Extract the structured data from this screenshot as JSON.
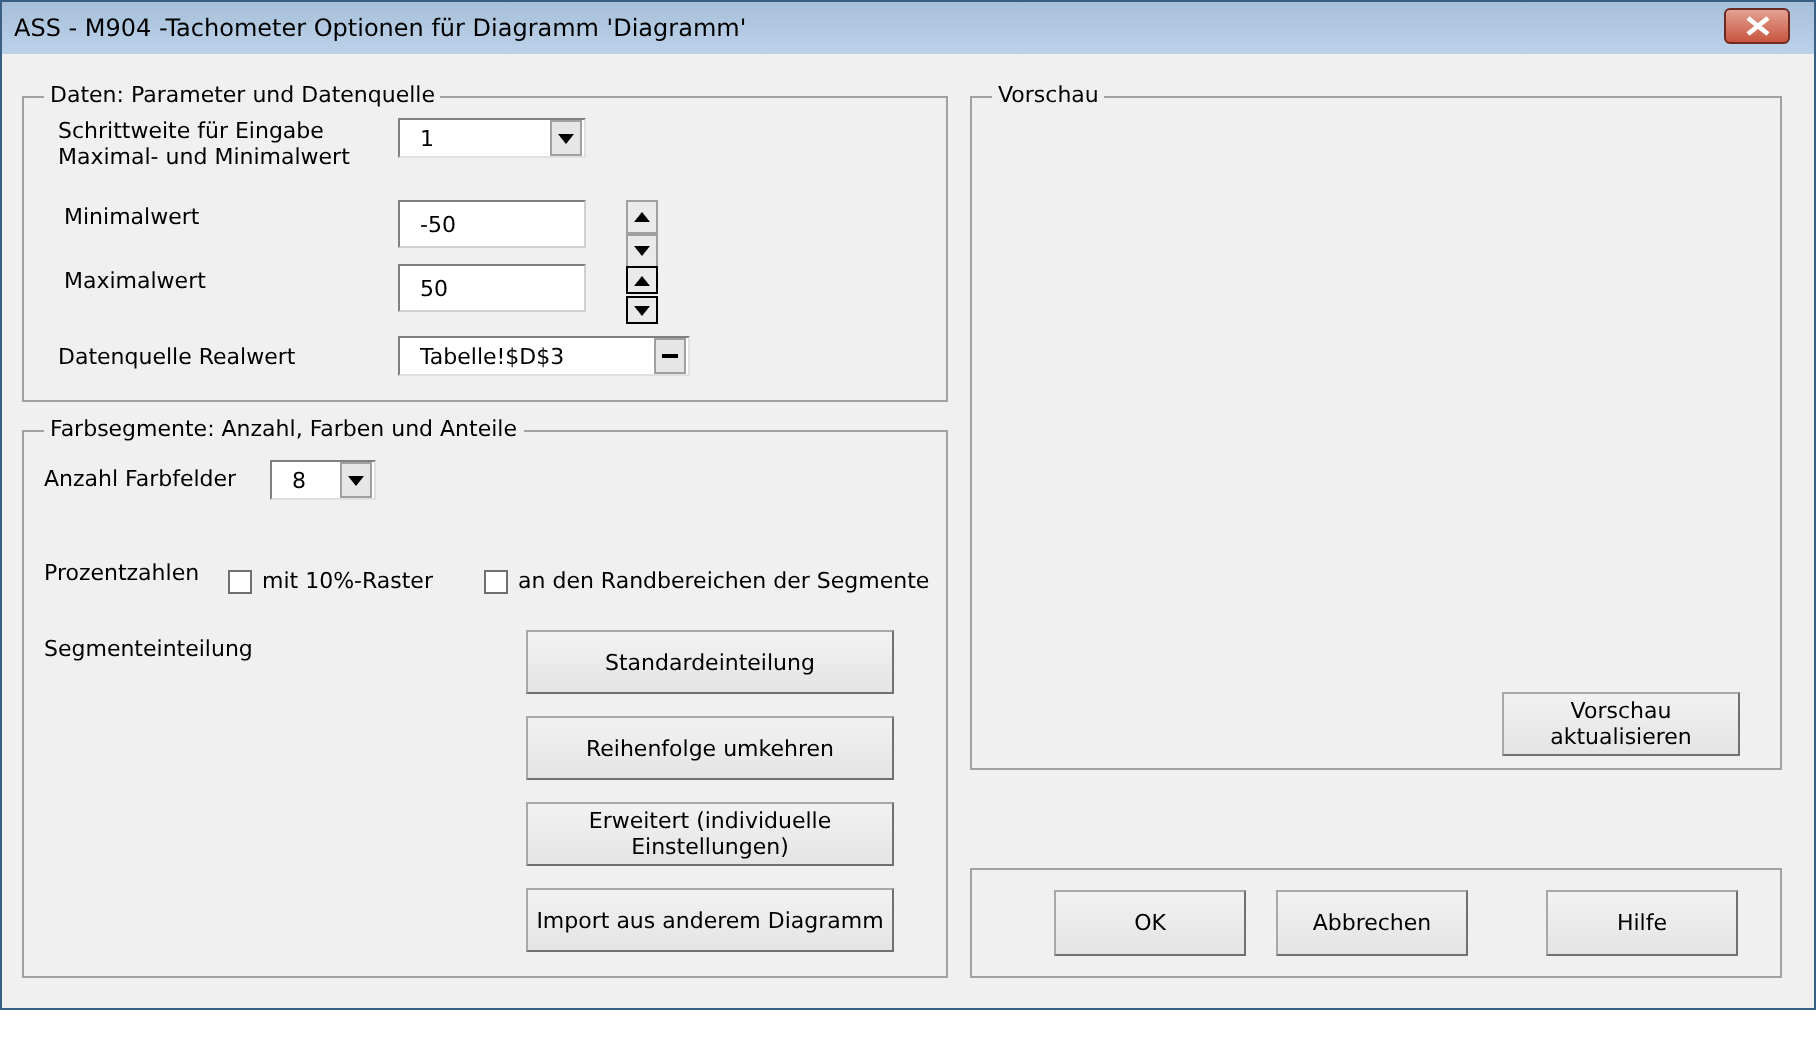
{
  "window": {
    "title": "ASS - M904 -Tachometer Optionen für Diagramm 'Diagramm'"
  },
  "data_group": {
    "legend": "Daten: Parameter und Datenquelle",
    "step": {
      "label": "Schrittweite für Eingabe Maximal- und Minimalwert",
      "value": "1"
    },
    "min": {
      "label": "Minimalwert",
      "value": "-50"
    },
    "max": {
      "label": "Maximalwert",
      "value": "50"
    },
    "source": {
      "label": "Datenquelle Realwert",
      "value": "Tabelle!$D$3"
    }
  },
  "segments_group": {
    "legend": "Farbsegmente: Anzahl, Farben und Anteile",
    "count": {
      "label": "Anzahl Farbfelder",
      "value": "8"
    },
    "percent": {
      "label": "Prozentzahlen",
      "options": [
        {
          "label": "mit 10%-Raster",
          "checked": false
        },
        {
          "label": "an den Randbereichen der Segmente",
          "checked": false
        }
      ]
    },
    "division": {
      "label": "Segmenteinteilung",
      "buttons": [
        "Standardeinteilung",
        "Reihenfolge umkehren",
        "Erweitert (individuelle Einstellungen)",
        "Import aus anderem Diagramm"
      ]
    }
  },
  "preview": {
    "legend": "Vorschau",
    "button": "Vorschau aktualisieren"
  },
  "buttons": [
    "OK",
    "Abbrechen",
    "Hilfe"
  ]
}
